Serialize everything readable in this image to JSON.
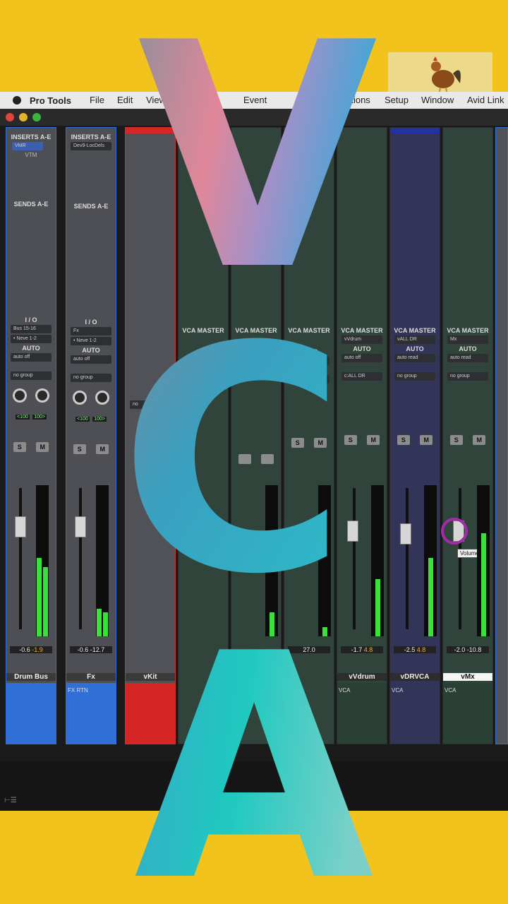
{
  "menubar": {
    "app_name": "Pro Tools",
    "menus": [
      "File",
      "Edit",
      "View",
      "Event",
      "Options",
      "Setup",
      "Window",
      "Avid Link"
    ]
  },
  "overlay": {
    "letters": [
      "V",
      "C",
      "A"
    ]
  },
  "strips": [
    {
      "label": "Drum Bus",
      "inserts_header": "INSERTS A-E",
      "insert1": "VMR",
      "insert2": "VTM",
      "sends_header": "SENDS A-E",
      "io_label": "I / O",
      "input": "Bus 15-16",
      "output": "• Neve 1-2",
      "auto_label": "AUTO",
      "auto_mode": "auto off",
      "group": "no group",
      "pan_left": "<100",
      "pan_right": "100>",
      "solo": "S",
      "mute": "M",
      "vol": "-0.6",
      "peak": "-1.9",
      "comment": "",
      "meter_l": 0.52,
      "meter_r": 0.46
    },
    {
      "label": "Fx",
      "inserts_header": "INSERTS A-E",
      "insert1": "Dev9-LocDels",
      "insert2": "",
      "sends_header": "SENDS A-E",
      "io_label": "I / O",
      "input": "Fx",
      "output": "• Neve 1-2",
      "auto_label": "AUTO",
      "auto_mode": "auto off",
      "group": "no group",
      "pan_left": "<100",
      "pan_right": "100>",
      "solo": "S",
      "mute": "M",
      "vol": "-0.6",
      "peak": "-12.7",
      "comment": "FX RTN",
      "meter_l": 0.18,
      "meter_r": 0.16
    },
    {
      "label": "vKit",
      "vol": "",
      "peak": "",
      "comment": "",
      "group": "no"
    },
    {
      "label": "",
      "vca_header": "VCA MASTER",
      "vol": "",
      "peak": "",
      "comment": ""
    },
    {
      "label": "",
      "vca_header": "VCA MASTER",
      "vol": "",
      "peak": "",
      "comment": ""
    },
    {
      "label": "",
      "vca_header": "VCA MASTER",
      "input": "",
      "vca_sel": "c:ALL DR",
      "auto_label": "AUTO",
      "auto_mode": "auto off",
      "group": "",
      "solo": "S",
      "mute": "M",
      "vol": "27.0",
      "peak": "",
      "comment": ""
    },
    {
      "label": "vVdrum",
      "vca_header": "VCA MASTER",
      "input": "vVdrum",
      "vca_sel": "c:ALL DR",
      "auto_label": "AUTO",
      "auto_mode": "auto off",
      "group": "no group",
      "solo": "S",
      "mute": "M",
      "vol": "-1.7",
      "peak": "4.8",
      "comment": "VCA",
      "meter_l": 0.38
    },
    {
      "label": "vDRVCA",
      "vca_header": "VCA MASTER",
      "input": "vALL DR",
      "auto_label": "AUTO",
      "auto_mode": "auto read",
      "group": "no group",
      "solo": "S",
      "mute": "M",
      "vol": "-2.5",
      "peak": "4.8",
      "comment": "VCA",
      "meter_l": 0.52
    },
    {
      "label": "vMx",
      "vca_header": "VCA MASTER",
      "input": "Mx",
      "auto_label": "AUTO",
      "auto_mode": "auto read",
      "group": "no group",
      "solo": "S",
      "mute": "M",
      "vol": "-2.0",
      "peak": "-10.8",
      "comment": "VCA",
      "meter_l": 0.68,
      "tooltip": "Volume"
    }
  ],
  "colors": {
    "background": "#f2c21d",
    "selected_name": "#ffffff",
    "accent_purple": "#a529a8"
  }
}
